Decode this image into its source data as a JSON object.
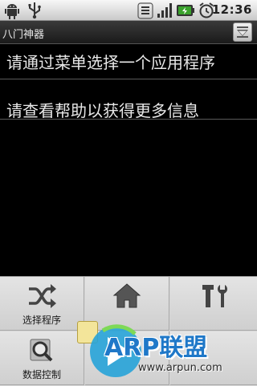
{
  "status_bar": {
    "icons": [
      "android-icon",
      "usb-icon",
      "signal-icon",
      "battery-icon",
      "alarm-icon"
    ],
    "time": "12:36"
  },
  "title_bar": {
    "title": "八门神器",
    "button_icon": "collapse-icon"
  },
  "content": {
    "line1": "请通过菜单选择一个应用程序",
    "line2": "请查看帮助以获得更多信息"
  },
  "menu": {
    "items": [
      {
        "label": "选择程序",
        "icon": "shuffle-icon"
      },
      {
        "label": "",
        "icon": "home-icon"
      },
      {
        "label": "",
        "icon": "tools-icon"
      },
      {
        "label": "数据控制",
        "icon": "search-icon"
      }
    ]
  },
  "watermark": {
    "brand": "ARP联盟",
    "url": "www.arpun.com"
  }
}
